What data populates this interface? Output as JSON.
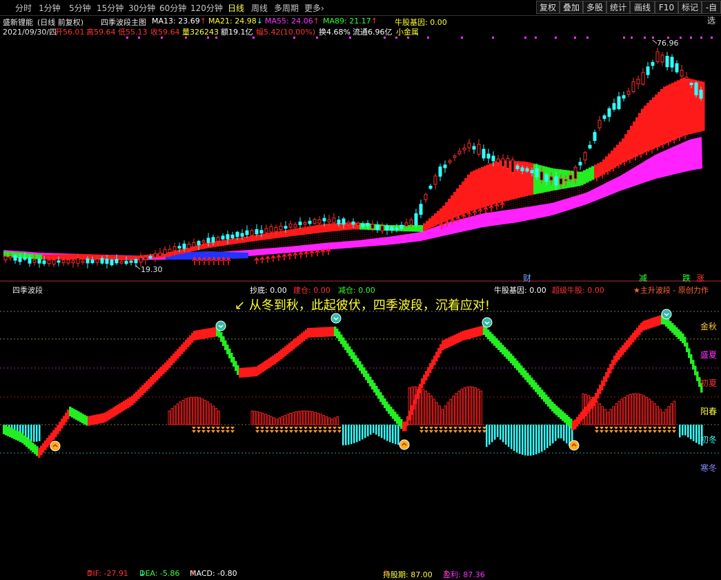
{
  "toolbar": {
    "periods": [
      "分时",
      "1分钟",
      "5分钟",
      "15分钟",
      "30分钟",
      "60分钟",
      "120分钟",
      "日线",
      "周线",
      "多周期",
      "更多"
    ],
    "more_caret": "›",
    "active_period": "日线",
    "buttons": [
      "复权",
      "叠加",
      "多股",
      "统计",
      "画线",
      "F10",
      "标记",
      "-自选"
    ]
  },
  "header": {
    "stock_name": "盛新锂能",
    "chart_mode": "(日线 前复权)",
    "indicator_name": "四季波段主图",
    "ma13": "MA13: 23.69",
    "ma13_arrow": "↑",
    "ma21": "MA21: 24.98",
    "ma21_arrow": "↓",
    "ma55": "MA55: 24.06",
    "ma55_arrow": "↑",
    "ma89": "MA89: 21.17",
    "ma89_arrow": "↑",
    "gene": "牛股基因: 0.00"
  },
  "quote": {
    "date": "2021/09/30/四",
    "open": "开56.01",
    "high": "高59.64",
    "low": "低55.13",
    "close": "收59.64",
    "volume": "量326243",
    "amount": "额19.1亿",
    "change": "幅5.42(10.00%)",
    "turnover": "换4.68%",
    "float_cap": "流通6.96亿",
    "sector": "小金属"
  },
  "main_chart": {
    "high_label": "76.96",
    "low_label": "19.30",
    "event_labels": [
      "财",
      "减",
      "跌",
      "涨"
    ]
  },
  "sub_panel": {
    "title": "四季波段",
    "dif": "DIF: -27.91",
    "dif_arrow": "↑",
    "dea": "DEA: -5.86",
    "dea_arrow": "↓",
    "macd": "MACD: -0.80",
    "macd_arrow": "↑",
    "chaodi": "抄底: 0.00",
    "jiancang": "建仓: 0.00",
    "jiancang2": "减仓: 0.00",
    "hold": "持股期: 87.00",
    "hold_arrow": "↑",
    "profit": "盈利: 87.36",
    "profit_arrow": "↑",
    "gene": "牛股基因: 0.00",
    "super": "超级牛股: 0.00",
    "brand": "★主升波段 - 原创力作",
    "slogan_mark": "↙",
    "slogan": "从冬到秋，此起彼伏，四季波段，沉着应对!",
    "seasons": [
      "金秋",
      "盛夏",
      "初夏",
      "阳春",
      "初冬",
      "寒冬"
    ]
  },
  "colors": {
    "up": "#ff2020",
    "down": "#33ffff",
    "band_up": "#ff1a1a",
    "band_down": "#22ee22",
    "magenta": "#ff22ff",
    "blue": "#2233ff",
    "yellow": "#ffff33"
  }
}
